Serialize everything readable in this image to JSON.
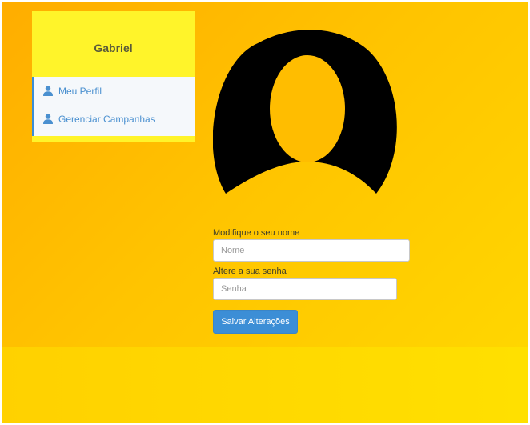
{
  "sidebar": {
    "user_name": "Gabriel",
    "items": [
      {
        "label": "Meu Perfil",
        "icon": "user-icon"
      },
      {
        "label": "Gerenciar Campanhas",
        "icon": "user-icon"
      }
    ]
  },
  "profile": {
    "avatar_icon": "default-avatar-icon"
  },
  "form": {
    "name_label": "Modifique o seu nome",
    "name_placeholder": "Nome",
    "name_value": "",
    "password_label": "Altere a sua senha",
    "password_placeholder": "Senha",
    "password_value": "",
    "save_label": "Salvar Alterações"
  },
  "colors": {
    "background_gradient": [
      "#ffad00",
      "#ffd900"
    ],
    "sidebar_bg": "#fff42a",
    "accent": "#3c8ed6",
    "menu_bg": "#f5f8fb"
  }
}
